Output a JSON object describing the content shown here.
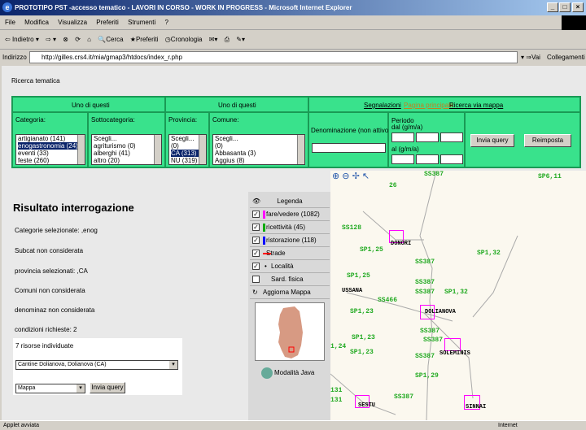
{
  "window": {
    "title": "PROTOTIPO PST -accesso tematico - LAVORI IN CORSO - WORK IN PROGRESS - Microsoft Internet Explorer"
  },
  "menu": [
    "File",
    "Modifica",
    "Visualizza",
    "Preferiti",
    "Strumenti",
    "?"
  ],
  "toolbar": {
    "back": "Indietro",
    "search": "Cerca",
    "favorites": "Preferiti",
    "history": "Cronologia"
  },
  "address": {
    "label": "Indirizzo",
    "url": "http://gilles.crs4.it/mia/gmap3/htdocs/index_r.php",
    "go": "Vai",
    "links": "Collegamenti"
  },
  "ricerca": {
    "title": "Ricerca tematica",
    "uno1": "Uno di questi",
    "uno2": "Uno di questi",
    "links": {
      "segnalazioni": "Segnalazioni",
      "pagina": "Pagina principale",
      "via": "Ricerca via mappa"
    },
    "categoria": {
      "label": "Categoria:",
      "items": [
        "artigianato (141)",
        "enogastronomia (24)",
        "eventi (33)",
        "feste (260)"
      ]
    },
    "sottocategoria": {
      "label": "Sottocategoria:",
      "items": [
        "Scegli...",
        "agriturismo (0)",
        "alberghi (41)",
        "altro (20)"
      ]
    },
    "provincia": {
      "label": "Provincia:",
      "items": [
        "Scegli...",
        "(0)",
        "CA (313)",
        "NU (319)"
      ]
    },
    "comune": {
      "label": "Comune:",
      "items": [
        "Scegli...",
        "(0)",
        "Abbasanta (3)",
        "Aggius (8)"
      ]
    },
    "denominazione": "Denominazione (non attivo):",
    "periodo": "Periodo",
    "dal": "dal (g/m/a)",
    "al": "al (g/m/a)",
    "invia": "Invia query",
    "reimposta": "Reimposta"
  },
  "risultato": {
    "title": "Risultato interrogazione",
    "lines": [
      "Categorie selezionate: ,enog",
      "Subcat non considerata",
      "provincia selezionati: ,CA",
      "Comuni non considerata",
      "denominaz non considerata",
      "condizioni richieste: 2"
    ],
    "count": "7 risorse individuate",
    "selected": "Cantine Dolianova, Dolianova (CA)",
    "mode": "Mappa",
    "invia": "Invia query"
  },
  "legenda": {
    "title": "Legenda",
    "items": [
      "fare/vedere (1082)",
      "ricettività (45)",
      "ristorazione (118)",
      "Strade",
      "Località",
      "Sard. fisica"
    ],
    "aggiorna": "Aggiorna Mappa",
    "java": "Modalità Java"
  },
  "map": {
    "roads": [
      "SS387",
      "SP6,11",
      "26",
      "SS128",
      "SP1,25",
      "SS387",
      "SP1,32",
      "SP1,25",
      "SS387",
      "SS466",
      "SS387",
      "SP1,32",
      "SP1,23",
      "SP1,23",
      "SS387",
      "SS387",
      "1,24",
      "SP1,23",
      "SS387",
      "SP1,29",
      "SS387",
      "131",
      "131"
    ],
    "towns": [
      "DONORI",
      "USSANA",
      "DOLIANOVA",
      "SOLEMINIS",
      "SESTU",
      "SINNAI"
    ]
  },
  "status": {
    "text": "Applet avviata",
    "zone": "Internet"
  }
}
